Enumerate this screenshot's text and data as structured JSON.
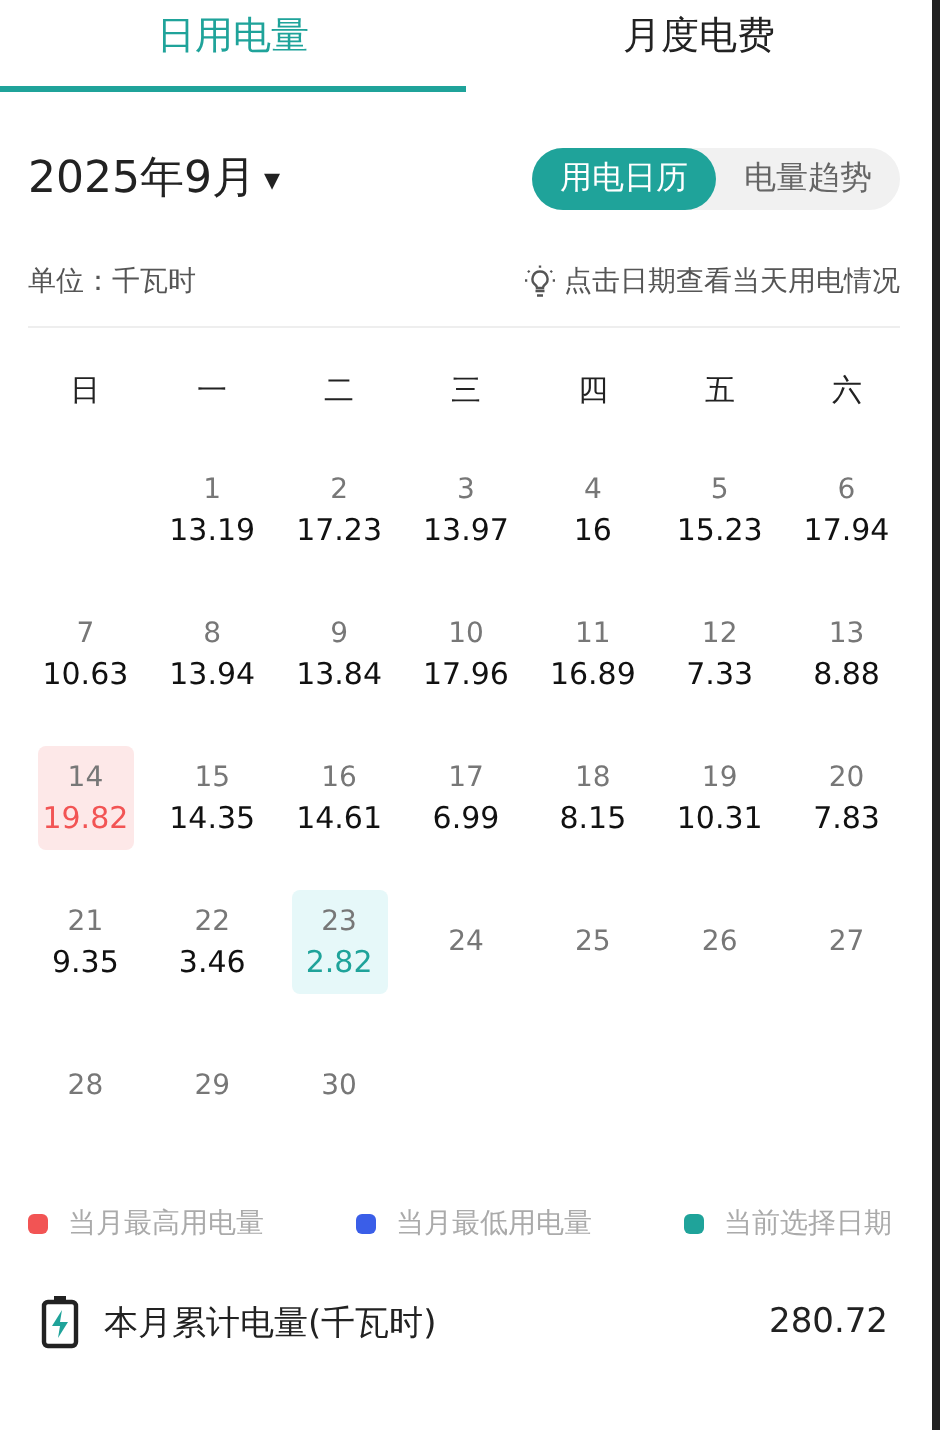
{
  "tabs": [
    {
      "label": "日用电量",
      "selected": true
    },
    {
      "label": "月度电费",
      "selected": false
    }
  ],
  "month_picker": {
    "label": "2025年9月",
    "caret": "▾"
  },
  "view_toggle": [
    {
      "label": "用电日历",
      "selected": true
    },
    {
      "label": "电量趋势",
      "selected": false
    }
  ],
  "unit": "单位：千瓦时",
  "hint": "点击日期查看当天用电情况",
  "weekdays": [
    "日",
    "一",
    "二",
    "三",
    "四",
    "五",
    "六"
  ],
  "weeks": [
    {
      "days": [
        {
          "day": "1",
          "value": "13.19",
          "highest": false,
          "selected": false
        },
        {
          "day": "2",
          "value": "17.23",
          "highest": false,
          "selected": false
        },
        {
          "day": "3",
          "value": "13.97",
          "highest": false,
          "selected": false
        },
        {
          "day": "4",
          "value": "16",
          "highest": false,
          "selected": false
        },
        {
          "day": "5",
          "value": "15.23",
          "highest": false,
          "selected": false
        },
        {
          "day": "6",
          "value": "17.94",
          "highest": false,
          "selected": false
        }
      ]
    },
    {
      "days": [
        {
          "day": "7",
          "value": "10.63",
          "highest": false,
          "selected": false
        },
        {
          "day": "8",
          "value": "13.94",
          "highest": false,
          "selected": false
        },
        {
          "day": "9",
          "value": "13.84",
          "highest": false,
          "selected": false
        },
        {
          "day": "10",
          "value": "17.96",
          "highest": false,
          "selected": false
        },
        {
          "day": "11",
          "value": "16.89",
          "highest": false,
          "selected": false
        },
        {
          "day": "12",
          "value": "7.33",
          "highest": false,
          "selected": false
        },
        {
          "day": "13",
          "value": "8.88",
          "highest": false,
          "selected": false
        }
      ]
    },
    {
      "days": [
        {
          "day": "14",
          "value": "19.82",
          "highest": true,
          "selected": false
        },
        {
          "day": "15",
          "value": "14.35",
          "highest": false,
          "selected": false
        },
        {
          "day": "16",
          "value": "14.61",
          "highest": false,
          "selected": false
        },
        {
          "day": "17",
          "value": "6.99",
          "highest": false,
          "selected": false
        },
        {
          "day": "18",
          "value": "8.15",
          "highest": false,
          "selected": false
        },
        {
          "day": "19",
          "value": "10.31",
          "highest": false,
          "selected": false
        },
        {
          "day": "20",
          "value": "7.83",
          "highest": false,
          "selected": false
        }
      ]
    },
    {
      "days": [
        {
          "day": "21",
          "value": "9.35",
          "highest": false,
          "selected": false
        },
        {
          "day": "22",
          "value": "3.46",
          "highest": false,
          "selected": false
        },
        {
          "day": "23",
          "value": "2.82",
          "highest": false,
          "selected": true
        },
        {
          "day": "24"
        },
        {
          "day": "25"
        },
        {
          "day": "26"
        },
        {
          "day": "27"
        }
      ]
    },
    {
      "days": [
        {
          "day": "28"
        },
        {
          "day": "29"
        },
        {
          "day": "30"
        }
      ]
    }
  ],
  "legend": [
    {
      "label": "当月最高用电量",
      "color": "#f25454"
    },
    {
      "label": "当月最低用电量",
      "color": "#3a5ee8"
    },
    {
      "label": "当前选择日期",
      "color": "#1fa39a"
    }
  ],
  "total": {
    "label": "本月累计电量(千瓦时)",
    "value": "280.72"
  }
}
